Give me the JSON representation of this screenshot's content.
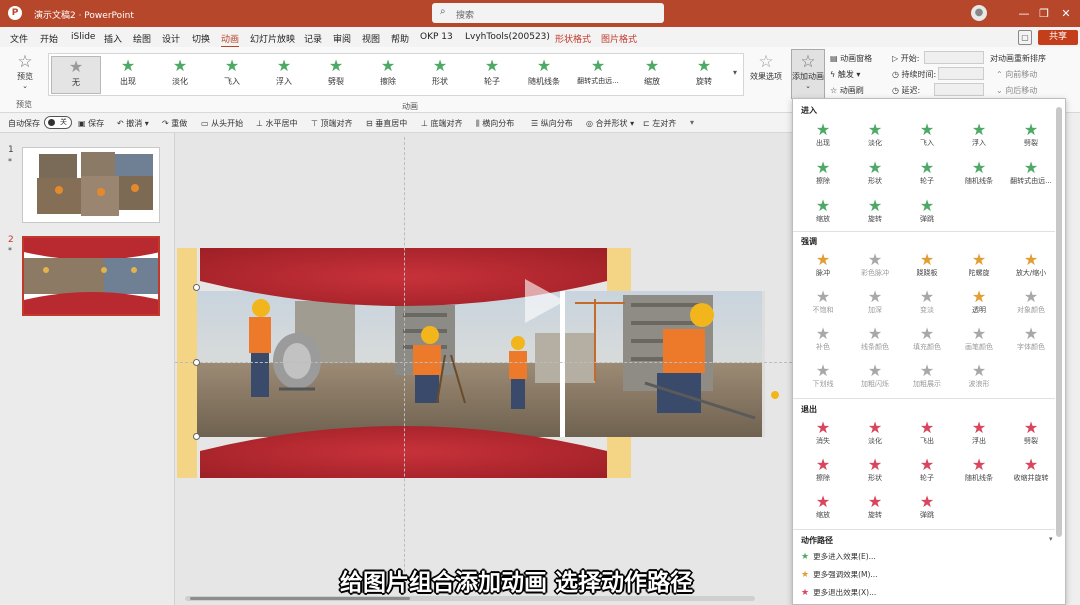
{
  "window": {
    "app_letter": "P",
    "title": "演示文稿2 · PowerPoint",
    "search_placeholder": "搜索",
    "minimize": "—",
    "restore": "❐",
    "close": "✕"
  },
  "menu": {
    "items": [
      "文件",
      "开始",
      "iSlide",
      "插入",
      "绘图",
      "设计",
      "切换",
      "动画",
      "幻灯片放映",
      "记录",
      "审阅",
      "视图",
      "帮助",
      "OKP 13",
      "LvyhTools(200523)",
      "形状格式",
      "图片格式"
    ],
    "active": "动画",
    "share": "共享",
    "comment": "▢"
  },
  "ribbon": {
    "preview": "预览",
    "preview_group": "预览",
    "animations": [
      "无",
      "出现",
      "淡化",
      "飞入",
      "浮入",
      "劈裂",
      "擦除",
      "形状",
      "轮子",
      "随机线条",
      "翻转式由远...",
      "缩放",
      "旋转"
    ],
    "animation_group": "动画",
    "effect_options": "效果选项",
    "add_animation": "添加动画",
    "animation_pane": "动画窗格",
    "trigger": "触发",
    "animation_painter": "动画刷",
    "start": "开始:",
    "duration": "持续时间:",
    "delay": "延迟:",
    "reorder_title": "对动画重新排序",
    "move_earlier": "向前移动",
    "move_later": "向后移动"
  },
  "qat": {
    "autosave": "自动保存",
    "autosave_state": "关",
    "items": [
      "保存",
      "撤消",
      "重做",
      "从头开始",
      "水平居中",
      "顶端对齐",
      "垂直居中",
      "底端对齐",
      "横向分布",
      "纵向分布",
      "合并形状",
      "左对齐"
    ]
  },
  "slides": [
    {
      "num": "1",
      "mark": "*"
    },
    {
      "num": "2",
      "mark": "*"
    }
  ],
  "dropdown": {
    "entry_title": "进入",
    "entry": [
      "出现",
      "淡化",
      "飞入",
      "浮入",
      "劈裂",
      "擦除",
      "形状",
      "轮子",
      "随机线条",
      "翻转式由远...",
      "缩放",
      "旋转",
      "弹跳"
    ],
    "emphasis_title": "强调",
    "emphasis": [
      {
        "label": "脉冲",
        "style": "emph"
      },
      {
        "label": "彩色脉冲",
        "style": "gray"
      },
      {
        "label": "跷跷板",
        "style": "emph"
      },
      {
        "label": "陀螺旋",
        "style": "emph"
      },
      {
        "label": "放大/缩小",
        "style": "emph"
      },
      {
        "label": "不饱和",
        "style": "gray"
      },
      {
        "label": "加深",
        "style": "gray"
      },
      {
        "label": "变淡",
        "style": "gray"
      },
      {
        "label": "透明",
        "style": "emph"
      },
      {
        "label": "对象颜色",
        "style": "gray"
      },
      {
        "label": "补色",
        "style": "gray"
      },
      {
        "label": "线条颜色",
        "style": "gray"
      },
      {
        "label": "填充颜色",
        "style": "gray"
      },
      {
        "label": "画笔颜色",
        "style": "gray"
      },
      {
        "label": "字体颜色",
        "style": "gray"
      },
      {
        "label": "下划线",
        "style": "gray"
      },
      {
        "label": "加粗闪烁",
        "style": "gray"
      },
      {
        "label": "加粗展示",
        "style": "gray"
      },
      {
        "label": "波浪形",
        "style": "gray"
      }
    ],
    "exit_title": "退出",
    "exit": [
      "消失",
      "淡化",
      "飞出",
      "浮出",
      "劈裂",
      "擦除",
      "形状",
      "轮子",
      "随机线条",
      "收缩并旋转",
      "缩放",
      "旋转",
      "弹跳"
    ],
    "path_title": "动作路径",
    "more": [
      "更多进入效果(E)...",
      "更多强调效果(M)...",
      "更多退出效果(X)..."
    ]
  },
  "subtitle": "给图片组合添加动画 选择动作路径",
  "colors": {
    "brand": "#b7472a",
    "banner": "#b82a30",
    "entry": "#4ea866",
    "emphasis": "#e39d33",
    "exit": "#d8455c"
  }
}
